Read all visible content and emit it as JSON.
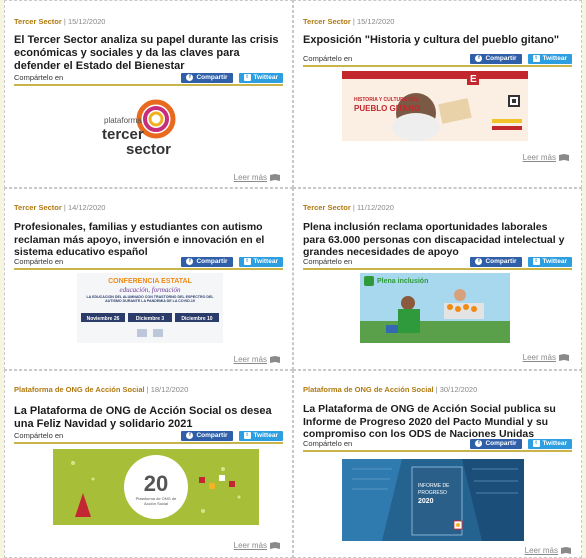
{
  "share_label": "Compártelo en",
  "fb_label": "Compartir",
  "tw_label": "Twittear",
  "more_label": "Leer más",
  "colors": {
    "category": "#b07a12",
    "underline": "#c9b44a",
    "facebook": "#2f5fa8",
    "twitter": "#2d9fe0",
    "background": "#f6f5df"
  },
  "cards": [
    {
      "category": "Tercer Sector",
      "date": "15/12/2020",
      "title": "El Tercer Sector analiza su papel durante las crisis económicas y sociales y da las claves para defender el Estado del Bienestar",
      "logo_line1": "plataforma",
      "logo_line2": "tercer",
      "logo_line3": "sector"
    },
    {
      "category": "Tercer Sector",
      "date": "15/12/2020",
      "title": "Exposición \"Historia y cultura del pueblo gitano\"",
      "poster_line1": "HISTORIA Y CULTURA DEL",
      "poster_line2": "PUEBLO GITANO"
    },
    {
      "category": "Tercer Sector",
      "date": "14/12/2020",
      "title": "Profesionales, familias y estudiantes con autismo reclaman más apoyo, inversión e innovación en el sistema educativo español",
      "banner_line1": "CONFERENCIA ESTATAL",
      "banner_line2": "educación, formación",
      "banner_line3": "LA EDUCACIÓN DEL ALUMNADO CON TRASTORNO DEL ESPECTRO DEL AUTISMO DURANTE LA PANDEMIA DE LA COVID-19",
      "banner_date1": "Noviembre 26",
      "banner_date2": "Diciembre 3",
      "banner_date3": "Diciembre 10"
    },
    {
      "category": "Tercer Sector",
      "date": "11/12/2020",
      "title": "Plena inclusión reclama oportunidades laborales para 63.000 personas con discapacidad intelectual y grandes necesidades de apoyo",
      "brand": "Plena inclusión"
    },
    {
      "category": "Plataforma de ONG de Acción Social",
      "date": "18/12/2020",
      "title": "La Plataforma de ONG de Acción Social os desea una Feliz Navidad y solidario 2021",
      "xmas_number": "20",
      "xmas_caption": "Plataforma de ONG de Acción Social"
    },
    {
      "category": "Plataforma de ONG de Acción Social",
      "date": "30/12/2020",
      "title": "La Plataforma de ONG de Acción Social publica su Informe de Progreso 2020 del Pacto Mundial y su compromiso con los ODS de Naciones Unidas",
      "report_line1": "INFORME DE",
      "report_line2": "PROGRESO",
      "report_line3": "2020"
    }
  ]
}
